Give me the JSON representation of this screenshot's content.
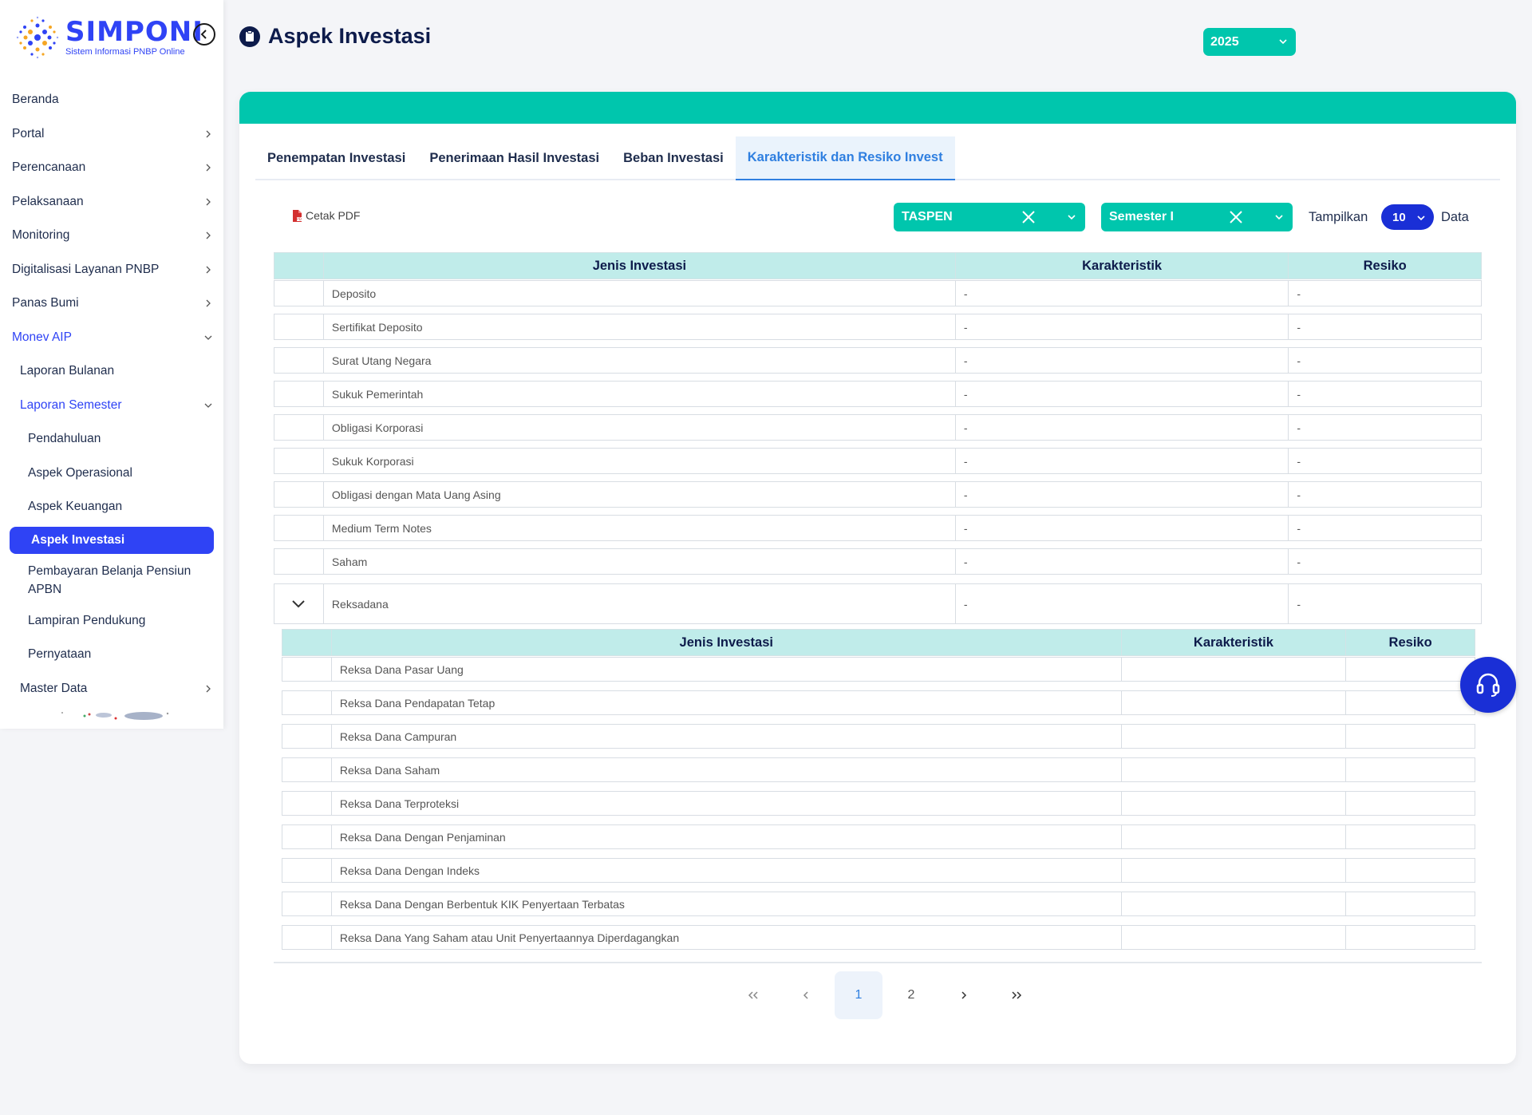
{
  "app": {
    "name": "SIMPONI",
    "tagline": "Sistem Informasi PNBP Online"
  },
  "sidebar": {
    "items": [
      {
        "label": "Beranda"
      },
      {
        "label": "Portal"
      },
      {
        "label": "Perencanaan"
      },
      {
        "label": "Pelaksanaan"
      },
      {
        "label": "Monitoring"
      },
      {
        "label": "Digitalisasi Layanan PNBP"
      },
      {
        "label": "Panas Bumi"
      },
      {
        "label": "Monev AIP"
      },
      {
        "label": "Laporan Bulanan"
      },
      {
        "label": "Laporan Semester"
      },
      {
        "label": "Pendahuluan"
      },
      {
        "label": "Aspek Operasional"
      },
      {
        "label": "Aspek Keuangan"
      },
      {
        "label": "Aspek Investasi"
      },
      {
        "label": "Pembayaran Belanja Pensiun APBN"
      },
      {
        "label": "Lampiran Pendukung"
      },
      {
        "label": "Pernyataan"
      },
      {
        "label": "Master Data"
      }
    ]
  },
  "header": {
    "title": "Aspek Investasi",
    "year": "2025"
  },
  "tabs": [
    {
      "label": "Penempatan Investasi"
    },
    {
      "label": "Penerimaan Hasil Investasi"
    },
    {
      "label": "Beban Investasi"
    },
    {
      "label": "Karakteristik dan Resiko Invest"
    }
  ],
  "toolbar": {
    "pdf_label": "Cetak PDF",
    "entity": "TASPEN",
    "semester": "Semester I",
    "show_label": "Tampilkan",
    "page_size": "10",
    "data_label": "Data"
  },
  "table": {
    "headers": [
      "Jenis Investasi",
      "Karakteristik",
      "Resiko"
    ],
    "rows": [
      {
        "jenis": "Deposito",
        "karakteristik": "-",
        "resiko": "-"
      },
      {
        "jenis": "Sertifikat Deposito",
        "karakteristik": "-",
        "resiko": "-"
      },
      {
        "jenis": "Surat Utang Negara",
        "karakteristik": "-",
        "resiko": "-"
      },
      {
        "jenis": "Sukuk Pemerintah",
        "karakteristik": "-",
        "resiko": "-"
      },
      {
        "jenis": "Obligasi Korporasi",
        "karakteristik": "-",
        "resiko": "-"
      },
      {
        "jenis": "Sukuk Korporasi",
        "karakteristik": "-",
        "resiko": "-"
      },
      {
        "jenis": "Obligasi dengan Mata Uang Asing",
        "karakteristik": "-",
        "resiko": "-"
      },
      {
        "jenis": "Medium Term Notes",
        "karakteristik": "-",
        "resiko": "-"
      },
      {
        "jenis": "Saham",
        "karakteristik": "-",
        "resiko": "-"
      },
      {
        "jenis": "Reksadana",
        "karakteristik": "-",
        "resiko": "-"
      }
    ]
  },
  "subtable": {
    "headers": [
      "Jenis Investasi",
      "Karakteristik",
      "Resiko"
    ],
    "rows": [
      {
        "jenis": "Reksa Dana Pasar Uang"
      },
      {
        "jenis": "Reksa Dana Pendapatan Tetap"
      },
      {
        "jenis": "Reksa Dana Campuran"
      },
      {
        "jenis": "Reksa Dana Saham"
      },
      {
        "jenis": "Reksa Dana Terproteksi"
      },
      {
        "jenis": "Reksa Dana Dengan Penjaminan"
      },
      {
        "jenis": "Reksa Dana Dengan Indeks"
      },
      {
        "jenis": "Reksa Dana Dengan Berbentuk KIK Penyertaan Terbatas"
      },
      {
        "jenis": "Reksa Dana Yang Saham atau Unit Penyertaannya Diperdagangkan"
      }
    ]
  },
  "pagination": {
    "pages": [
      "1",
      "2"
    ],
    "current": "1"
  },
  "colors": {
    "accent": "#00c6ad",
    "brand": "#2f43f5",
    "active_tab": "#2f7fe0",
    "header_bg": "#c0ecea"
  },
  "icons": {
    "collapse": "chevron-left-circle-icon",
    "title": "clipboard-icon",
    "pdf": "pdf-file-icon",
    "clear": "close-icon",
    "dropdown": "chevron-down-icon",
    "help": "headset-icon"
  }
}
